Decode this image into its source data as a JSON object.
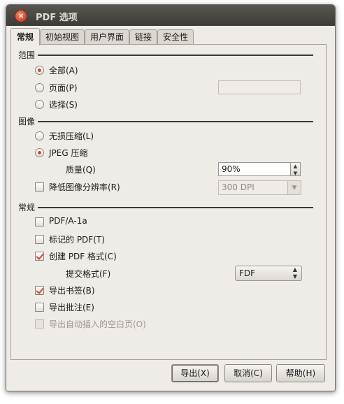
{
  "window": {
    "title": "PDF 选项"
  },
  "tabs": [
    "常规",
    "初始视图",
    "用户界面",
    "链接",
    "安全性"
  ],
  "range": {
    "title": "范围",
    "all": "全部(A)",
    "pages": "页面(P)",
    "pages_value": "",
    "selection": "选择(S)",
    "selected": "all"
  },
  "image": {
    "title": "图像",
    "lossless": "无损压缩(L)",
    "jpeg": "JPEG 压缩",
    "quality_label": "质量(Q)",
    "quality_value": "90%",
    "reduce_resolution": "降低图像分辨率(R)",
    "resolution_value": "300 DPI",
    "selected": "jpeg"
  },
  "general": {
    "title": "常规",
    "pdfa": "PDF/A-1a",
    "tagged": "标记的 PDF(T)",
    "create_form": "创建 PDF 格式(C)",
    "submit_format_label": "提交格式(F)",
    "submit_format_value": "FDF",
    "export_bookmarks": "导出书签(B)",
    "export_comments": "导出批注(E)",
    "export_blank_pages": "导出自动插入的空白页(O)"
  },
  "buttons": {
    "export": "导出(X)",
    "cancel": "取消(C)",
    "help": "帮助(H)"
  },
  "colors": {
    "accent": "#d24a2c"
  }
}
